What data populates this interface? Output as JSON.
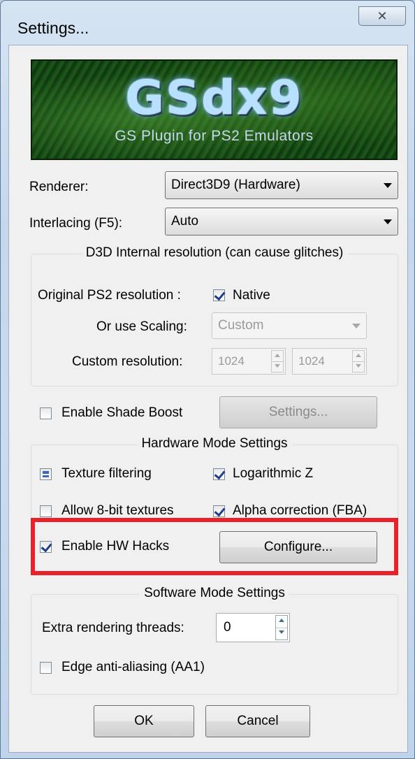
{
  "window": {
    "title": "Settings...",
    "close_label": "✕"
  },
  "banner": {
    "logo_text": "GSdx9",
    "tagline": "GS Plugin for PS2 Emulators"
  },
  "renderer": {
    "label": "Renderer:",
    "value": "Direct3D9 (Hardware)"
  },
  "interlacing": {
    "label": "Interlacing (F5):",
    "value": "Auto"
  },
  "d3d_group": {
    "title": "D3D Internal resolution (can cause glitches)",
    "original_label": "Original PS2 resolution :",
    "native_label": "Native",
    "native_checked": true,
    "scaling_label": "Or use Scaling:",
    "scaling_value": "Custom",
    "custom_label": "Custom resolution:",
    "custom_width": "1024",
    "custom_height": "1024"
  },
  "shade_boost": {
    "label": "Enable Shade Boost",
    "checked": false,
    "settings_button": "Settings..."
  },
  "hardware_group": {
    "title": "Hardware Mode Settings",
    "texture_filtering": "Texture filtering",
    "texture_filtering_state": "indeterminate",
    "logarithmic_z": "Logarithmic Z",
    "logarithmic_z_checked": true,
    "allow_8bit": "Allow 8-bit textures",
    "allow_8bit_checked": false,
    "alpha_correction": "Alpha correction (FBA)",
    "alpha_correction_checked": true,
    "hw_hacks": "Enable HW Hacks",
    "hw_hacks_checked": true,
    "configure_button": "Configure..."
  },
  "highlight_color": "#e8222a",
  "software_group": {
    "title": "Software Mode Settings",
    "threads_label": "Extra rendering threads:",
    "threads_value": "0",
    "edge_aa": "Edge anti-aliasing (AA1)",
    "edge_aa_checked": false
  },
  "footer": {
    "ok": "OK",
    "cancel": "Cancel"
  }
}
